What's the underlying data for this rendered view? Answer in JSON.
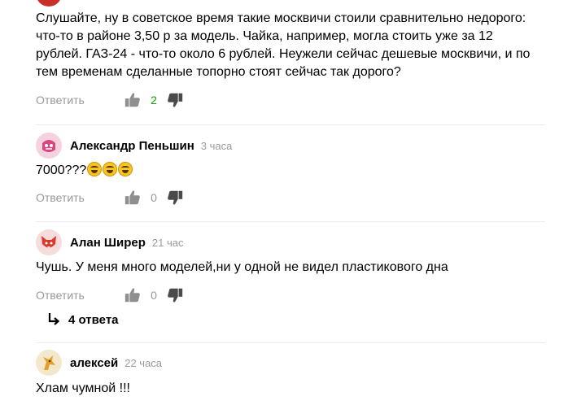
{
  "comment_top": {
    "text": "Слушайте, ну в советское время такие москвичи стоили сравнительно недорого: что-то в районе 3,50 р за модель. Чайка, например, могла стоить уже за 12 рублей. ГАЗ-24 - что-то около 6 рублей. Неужели сейчас дешевые москвичи, и по тем временам сделанные топорно стоят сейчас так дорого?",
    "reply_label": "Ответить",
    "likes": "2"
  },
  "comment_1": {
    "author": "Александр Пеньшин",
    "time": "3 часа",
    "text": "7000???",
    "reply_label": "Ответить",
    "likes": "0"
  },
  "comment_2": {
    "author": "Алан Ширер",
    "time": "21 час",
    "text": "Чушь. У меня много моделей,ни у одной не видел пластикового дна",
    "reply_label": "Ответить",
    "likes": "0",
    "replies_label": "4 ответа"
  },
  "comment_3": {
    "author": "алексей",
    "time": "22 часа",
    "text": "Хлам чумной !!!"
  },
  "colors": {
    "like_positive": "#13a10e",
    "muted": "#9a9a9a",
    "avatar_1": "#f4d3de",
    "avatar_2": "#f7dcdc",
    "avatar_3": "#f3e7cc"
  }
}
